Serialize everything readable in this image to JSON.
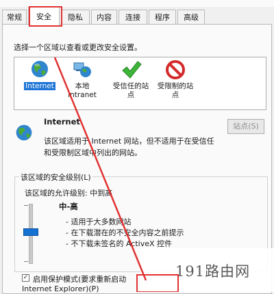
{
  "tabs": [
    {
      "label": "常规"
    },
    {
      "label": "安全"
    },
    {
      "label": "隐私"
    },
    {
      "label": "内容"
    },
    {
      "label": "连接"
    },
    {
      "label": "程序"
    },
    {
      "label": "高级"
    }
  ],
  "instruction": "选择一个区域以查看或更改安全设置。",
  "zones": [
    {
      "line1": "Internet",
      "line2": ""
    },
    {
      "line1": "本地",
      "line2": "intranet"
    },
    {
      "line1": "受信任的站",
      "line2": "点"
    },
    {
      "line1": "受限制的站",
      "line2": "点"
    }
  ],
  "selected_zone": {
    "title": "Internet",
    "desc1": "该区域适用于 Internet 网站，但不适用于在受信任",
    "desc2": "和受限制区域中列出的网站。",
    "sites_button": "站点(S)"
  },
  "security_level": {
    "group_title": "该区域的安全级别(L)",
    "allowed_label": "该区域的允许级别: 中到高",
    "level_name": "中-高",
    "bullets": [
      "- 适用于大多数网站",
      "- 在下载潜在的不安全内容之前提示",
      "- 不下载未签名的 ActiveX 控件"
    ]
  },
  "protected_mode": {
    "label1": "启用保护模式(要求重新启动",
    "label2": "Internet Explorer)(P)",
    "checked": "✓"
  },
  "watermark": "191路由网",
  "colors": {
    "highlight_red": "#e23131",
    "selection_blue": "#1d74d6"
  }
}
